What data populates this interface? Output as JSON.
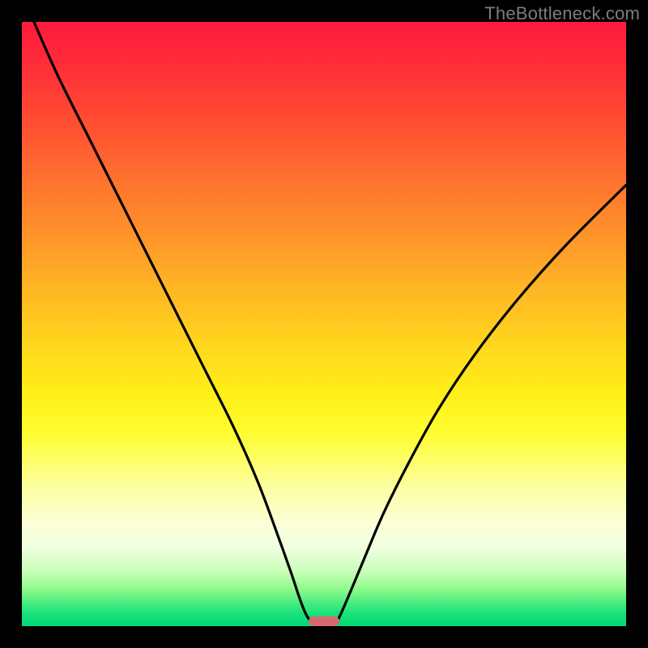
{
  "watermark": "TheBottleneck.com",
  "chart_data": {
    "type": "line",
    "title": "",
    "xlabel": "",
    "ylabel": "",
    "xlim": [
      0,
      100
    ],
    "ylim": [
      0,
      100
    ],
    "grid": false,
    "legend": false,
    "background_gradient": {
      "top": "#ff1a3d",
      "mid": "#fff018",
      "bottom": "#00d877"
    },
    "series": [
      {
        "name": "left-curve",
        "x": [
          2,
          6,
          12,
          18,
          24,
          30,
          35,
          39,
          42,
          44.5,
          46,
          47,
          47.8
        ],
        "y": [
          100,
          91,
          79,
          67,
          55,
          43,
          33,
          24,
          16,
          9,
          4.5,
          2,
          0.8
        ]
      },
      {
        "name": "right-curve",
        "x": [
          52.2,
          53,
          54.5,
          57,
          60,
          64,
          69,
          75,
          82,
          90,
          100
        ],
        "y": [
          0.8,
          2.5,
          6,
          12,
          19,
          27,
          36,
          45,
          54,
          63,
          73
        ]
      }
    ],
    "marker": {
      "name": "bottleneck-indicator",
      "x_center": 50,
      "y": 0.8,
      "width": 5,
      "height": 1.6,
      "color": "#d86a6d"
    }
  }
}
